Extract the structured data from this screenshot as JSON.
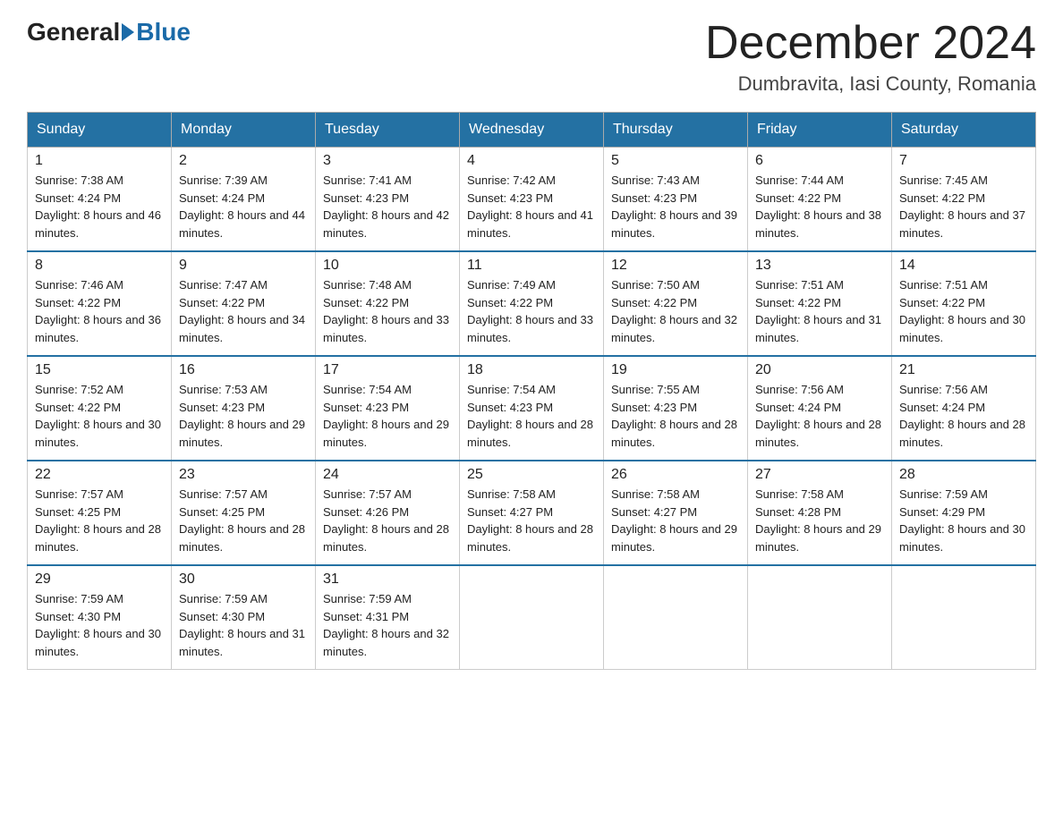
{
  "header": {
    "logo_general": "General",
    "logo_blue": "Blue",
    "month_title": "December 2024",
    "location": "Dumbravita, Iasi County, Romania"
  },
  "weekdays": [
    "Sunday",
    "Monday",
    "Tuesday",
    "Wednesday",
    "Thursday",
    "Friday",
    "Saturday"
  ],
  "weeks": [
    [
      {
        "day": "1",
        "sunrise": "7:38 AM",
        "sunset": "4:24 PM",
        "daylight": "8 hours and 46 minutes."
      },
      {
        "day": "2",
        "sunrise": "7:39 AM",
        "sunset": "4:24 PM",
        "daylight": "8 hours and 44 minutes."
      },
      {
        "day": "3",
        "sunrise": "7:41 AM",
        "sunset": "4:23 PM",
        "daylight": "8 hours and 42 minutes."
      },
      {
        "day": "4",
        "sunrise": "7:42 AM",
        "sunset": "4:23 PM",
        "daylight": "8 hours and 41 minutes."
      },
      {
        "day": "5",
        "sunrise": "7:43 AM",
        "sunset": "4:23 PM",
        "daylight": "8 hours and 39 minutes."
      },
      {
        "day": "6",
        "sunrise": "7:44 AM",
        "sunset": "4:22 PM",
        "daylight": "8 hours and 38 minutes."
      },
      {
        "day": "7",
        "sunrise": "7:45 AM",
        "sunset": "4:22 PM",
        "daylight": "8 hours and 37 minutes."
      }
    ],
    [
      {
        "day": "8",
        "sunrise": "7:46 AM",
        "sunset": "4:22 PM",
        "daylight": "8 hours and 36 minutes."
      },
      {
        "day": "9",
        "sunrise": "7:47 AM",
        "sunset": "4:22 PM",
        "daylight": "8 hours and 34 minutes."
      },
      {
        "day": "10",
        "sunrise": "7:48 AM",
        "sunset": "4:22 PM",
        "daylight": "8 hours and 33 minutes."
      },
      {
        "day": "11",
        "sunrise": "7:49 AM",
        "sunset": "4:22 PM",
        "daylight": "8 hours and 33 minutes."
      },
      {
        "day": "12",
        "sunrise": "7:50 AM",
        "sunset": "4:22 PM",
        "daylight": "8 hours and 32 minutes."
      },
      {
        "day": "13",
        "sunrise": "7:51 AM",
        "sunset": "4:22 PM",
        "daylight": "8 hours and 31 minutes."
      },
      {
        "day": "14",
        "sunrise": "7:51 AM",
        "sunset": "4:22 PM",
        "daylight": "8 hours and 30 minutes."
      }
    ],
    [
      {
        "day": "15",
        "sunrise": "7:52 AM",
        "sunset": "4:22 PM",
        "daylight": "8 hours and 30 minutes."
      },
      {
        "day": "16",
        "sunrise": "7:53 AM",
        "sunset": "4:23 PM",
        "daylight": "8 hours and 29 minutes."
      },
      {
        "day": "17",
        "sunrise": "7:54 AM",
        "sunset": "4:23 PM",
        "daylight": "8 hours and 29 minutes."
      },
      {
        "day": "18",
        "sunrise": "7:54 AM",
        "sunset": "4:23 PM",
        "daylight": "8 hours and 28 minutes."
      },
      {
        "day": "19",
        "sunrise": "7:55 AM",
        "sunset": "4:23 PM",
        "daylight": "8 hours and 28 minutes."
      },
      {
        "day": "20",
        "sunrise": "7:56 AM",
        "sunset": "4:24 PM",
        "daylight": "8 hours and 28 minutes."
      },
      {
        "day": "21",
        "sunrise": "7:56 AM",
        "sunset": "4:24 PM",
        "daylight": "8 hours and 28 minutes."
      }
    ],
    [
      {
        "day": "22",
        "sunrise": "7:57 AM",
        "sunset": "4:25 PM",
        "daylight": "8 hours and 28 minutes."
      },
      {
        "day": "23",
        "sunrise": "7:57 AM",
        "sunset": "4:25 PM",
        "daylight": "8 hours and 28 minutes."
      },
      {
        "day": "24",
        "sunrise": "7:57 AM",
        "sunset": "4:26 PM",
        "daylight": "8 hours and 28 minutes."
      },
      {
        "day": "25",
        "sunrise": "7:58 AM",
        "sunset": "4:27 PM",
        "daylight": "8 hours and 28 minutes."
      },
      {
        "day": "26",
        "sunrise": "7:58 AM",
        "sunset": "4:27 PM",
        "daylight": "8 hours and 29 minutes."
      },
      {
        "day": "27",
        "sunrise": "7:58 AM",
        "sunset": "4:28 PM",
        "daylight": "8 hours and 29 minutes."
      },
      {
        "day": "28",
        "sunrise": "7:59 AM",
        "sunset": "4:29 PM",
        "daylight": "8 hours and 30 minutes."
      }
    ],
    [
      {
        "day": "29",
        "sunrise": "7:59 AM",
        "sunset": "4:30 PM",
        "daylight": "8 hours and 30 minutes."
      },
      {
        "day": "30",
        "sunrise": "7:59 AM",
        "sunset": "4:30 PM",
        "daylight": "8 hours and 31 minutes."
      },
      {
        "day": "31",
        "sunrise": "7:59 AM",
        "sunset": "4:31 PM",
        "daylight": "8 hours and 32 minutes."
      },
      null,
      null,
      null,
      null
    ]
  ]
}
